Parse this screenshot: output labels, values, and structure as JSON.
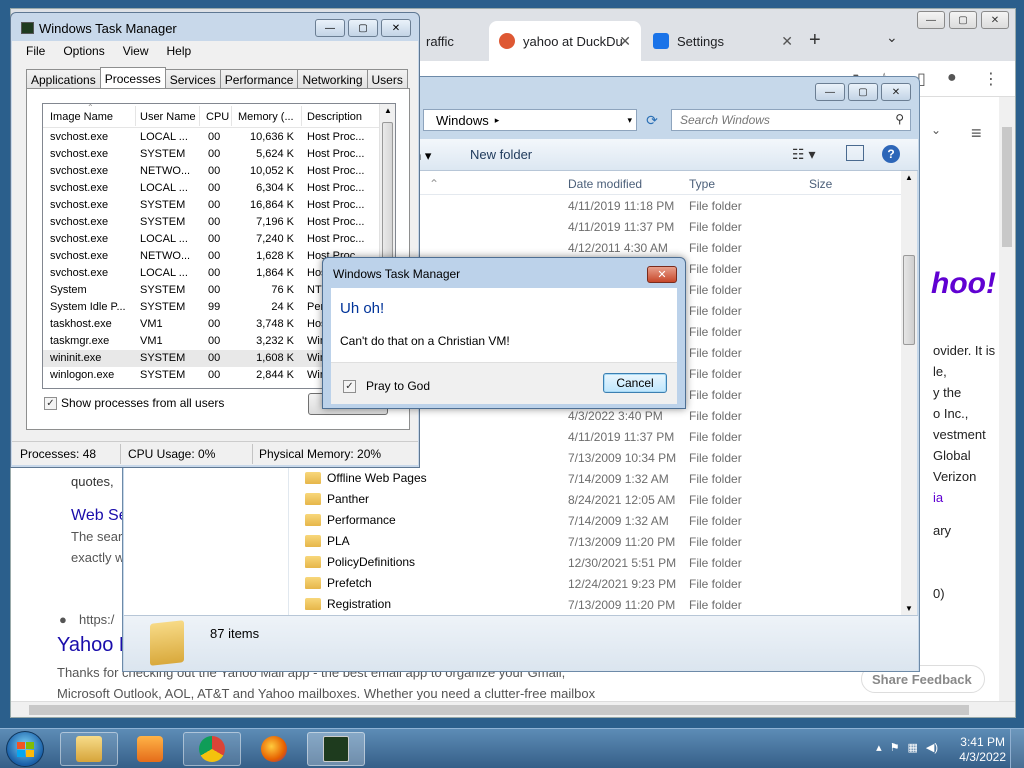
{
  "browser": {
    "tabs": [
      {
        "label": "raffic",
        "favicon_color": "#1a73e8"
      },
      {
        "label": "yahoo at DuckDu",
        "favicon_color": "#de5833"
      },
      {
        "label": "Settings",
        "favicon_color": "#1a73e8"
      }
    ],
    "new_tab_icon": "+",
    "page_fragments": {
      "line1": "ovider. It is",
      "line2": "le,",
      "line3": "y the",
      "line4": "o Inc.,",
      "line5": "vestment",
      "line6": "Global",
      "line7": "Verizon",
      "line8": "ia",
      "line9": "ary",
      "line10": "0)",
      "quotes": "quotes,",
      "web_se": "Web Se",
      "the_sear": "The sear",
      "exactly": "exactly w",
      "https": "https:/",
      "yahoo_result": "Yahoo M",
      "snippet1": "Thanks for checking out the Yahoo Mail app - the best email app to organize your Gmail,",
      "snippet2": "Microsoft Outlook, AOL, AT&T and Yahoo mailboxes. Whether you need a clutter-free mailbox",
      "share_feedback": "Share Feedback",
      "logo_text": "hoo!"
    }
  },
  "explorer": {
    "address": "Windows",
    "search_placeholder": "Search Windows",
    "organize_chevron": "n",
    "new_folder": "New folder",
    "columns": {
      "date": "Date modified",
      "type": "Type",
      "size": "Size"
    },
    "rows": [
      {
        "name": "",
        "date": "4/11/2019 11:18 PM",
        "type": "File folder"
      },
      {
        "name": "",
        "date": "4/11/2019 11:37 PM",
        "type": "File folder"
      },
      {
        "name": "",
        "date": "4/12/2011 4:30 AM",
        "type": "File folder"
      },
      {
        "name": "",
        "date": "",
        "type": "File folder"
      },
      {
        "name": "",
        "date": "",
        "type": "File folder"
      },
      {
        "name": "",
        "date": "",
        "type": "File folder"
      },
      {
        "name": "",
        "date": "",
        "type": "File folder"
      },
      {
        "name": "",
        "date": "",
        "type": "File folder"
      },
      {
        "name": "",
        "date": "",
        "type": "File folder"
      },
      {
        "name": "",
        "date": "",
        "type": "File folder"
      },
      {
        "name": "",
        "date": "4/3/2022 3:40 PM",
        "type": "File folder"
      },
      {
        "name": "",
        "date": "4/11/2019 11:37 PM",
        "type": "File folder"
      },
      {
        "name": "",
        "date": "7/13/2009 10:34 PM",
        "type": "File folder"
      },
      {
        "name": "Offline Web Pages",
        "date": "7/14/2009 1:32 AM",
        "type": "File folder"
      },
      {
        "name": "Panther",
        "date": "8/24/2021 12:05 AM",
        "type": "File folder"
      },
      {
        "name": "Performance",
        "date": "7/14/2009 1:32 AM",
        "type": "File folder"
      },
      {
        "name": "PLA",
        "date": "7/13/2009 11:20 PM",
        "type": "File folder"
      },
      {
        "name": "PolicyDefinitions",
        "date": "12/30/2021 5:51 PM",
        "type": "File folder"
      },
      {
        "name": "Prefetch",
        "date": "12/24/2021 9:23 PM",
        "type": "File folder"
      },
      {
        "name": "Registration",
        "date": "7/13/2009 11:20 PM",
        "type": "File folder"
      }
    ],
    "item_count": "87 items"
  },
  "taskmgr": {
    "title": "Windows Task Manager",
    "menu": [
      "File",
      "Options",
      "View",
      "Help"
    ],
    "tabs": [
      "Applications",
      "Processes",
      "Services",
      "Performance",
      "Networking",
      "Users"
    ],
    "active_tab": "Processes",
    "columns": [
      "Image Name",
      "User Name",
      "CPU",
      "Memory (...",
      "Description"
    ],
    "processes": [
      [
        "svchost.exe",
        "LOCAL ...",
        "00",
        "10,636 K",
        "Host Proc..."
      ],
      [
        "svchost.exe",
        "SYSTEM",
        "00",
        "5,624 K",
        "Host Proc..."
      ],
      [
        "svchost.exe",
        "NETWO...",
        "00",
        "10,052 K",
        "Host Proc..."
      ],
      [
        "svchost.exe",
        "LOCAL ...",
        "00",
        "6,304 K",
        "Host Proc..."
      ],
      [
        "svchost.exe",
        "SYSTEM",
        "00",
        "16,864 K",
        "Host Proc..."
      ],
      [
        "svchost.exe",
        "SYSTEM",
        "00",
        "7,196 K",
        "Host Proc..."
      ],
      [
        "svchost.exe",
        "LOCAL ...",
        "00",
        "7,240 K",
        "Host Proc..."
      ],
      [
        "svchost.exe",
        "NETWO...",
        "00",
        "1,628 K",
        "Host Proc..."
      ],
      [
        "svchost.exe",
        "LOCAL ...",
        "00",
        "1,864 K",
        "Hos"
      ],
      [
        "System",
        "SYSTEM",
        "00",
        "76 K",
        "NT"
      ],
      [
        "System Idle P...",
        "SYSTEM",
        "99",
        "24 K",
        "Per"
      ],
      [
        "taskhost.exe",
        "VM1",
        "00",
        "3,748 K",
        "Hos"
      ],
      [
        "taskmgr.exe",
        "VM1",
        "00",
        "3,232 K",
        "Win"
      ],
      [
        "wininit.exe",
        "SYSTEM",
        "00",
        "1,608 K",
        "Win"
      ],
      [
        "winlogon.exe",
        "SYSTEM",
        "00",
        "2,844 K",
        "Win"
      ]
    ],
    "selected_row": 13,
    "show_all_label": "Show processes from all users",
    "end_button": "E",
    "status": {
      "processes": "Processes: 48",
      "cpu": "CPU Usage: 0%",
      "memory": "Physical Memory: 20%"
    }
  },
  "dialog": {
    "title": "Windows Task Manager",
    "heading": "Uh oh!",
    "message": "Can't do that on a Christian VM!",
    "checkbox_label": "Pray to God",
    "checkbox_checked": true,
    "cancel_label": "Cancel",
    "close_glyph": "✕"
  },
  "taskbar": {
    "clock_time": "3:41 PM",
    "clock_date": "4/3/2022",
    "apps": [
      "explorer",
      "media-player",
      "chrome",
      "firefox",
      "task-manager"
    ]
  },
  "icons": {
    "check": "✓",
    "down": "▾",
    "right": "▸",
    "minimize": "—",
    "maximize": "▢",
    "close": "✕"
  }
}
